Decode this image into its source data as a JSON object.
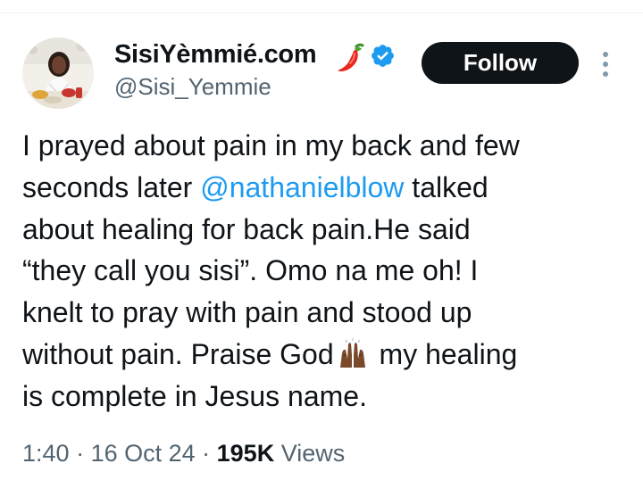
{
  "author": {
    "display_name": "SisiYèmmié.com",
    "handle": "@Sisi_Yemmie",
    "verified": true,
    "icons": [
      "avatar-photo",
      "chili-pepper-icon",
      "verified-badge-icon"
    ],
    "verified_color": "#1d9bf0"
  },
  "actions": {
    "follow_label": "Follow",
    "more_icon": "more-vertical-icon"
  },
  "tweet": {
    "lines": [
      {
        "pre": "I prayed about pain in my back and few"
      },
      {
        "pre": "seconds later ",
        "mention": "@nathanielblow",
        "post": " talked"
      },
      {
        "pre": "about healing for back pain.He said"
      },
      {
        "pre": "“they call you sisi”.  Omo na me oh! I"
      },
      {
        "pre": "knelt to pray with pain and stood up"
      },
      {
        "pre": "without pain. Praise God",
        "icon": "raised-hands-emoji",
        "post": " my healing"
      },
      {
        "pre": "is complete in Jesus name."
      }
    ],
    "mention_color": "#1d9bf0"
  },
  "meta": {
    "time": "1:40",
    "separator": " · ",
    "date": "16 Oct 24",
    "views_count": "195K",
    "views_label": " Views"
  }
}
